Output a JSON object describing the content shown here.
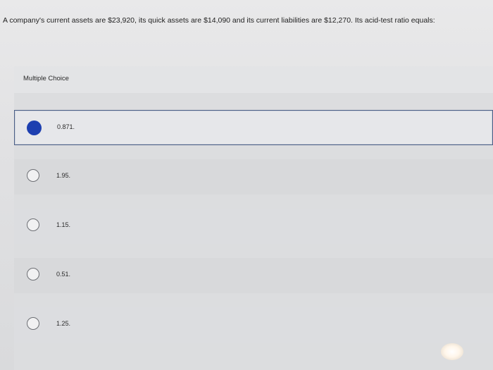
{
  "question": {
    "text": "A company's current assets are $23,920, its quick assets are $14,090 and its current liabilities are $12,270. Its acid-test ratio equals:"
  },
  "multiple_choice": {
    "label": "Multiple Choice",
    "selected_index": 0,
    "options": [
      {
        "label": "0.871.",
        "selected": true
      },
      {
        "label": "1.95.",
        "selected": false
      },
      {
        "label": "1.15.",
        "selected": false
      },
      {
        "label": "0.51.",
        "selected": false
      },
      {
        "label": "1.25.",
        "selected": false
      }
    ]
  },
  "colors": {
    "selected_radio": "#1d3fb0",
    "selected_border": "#4a5e86"
  }
}
